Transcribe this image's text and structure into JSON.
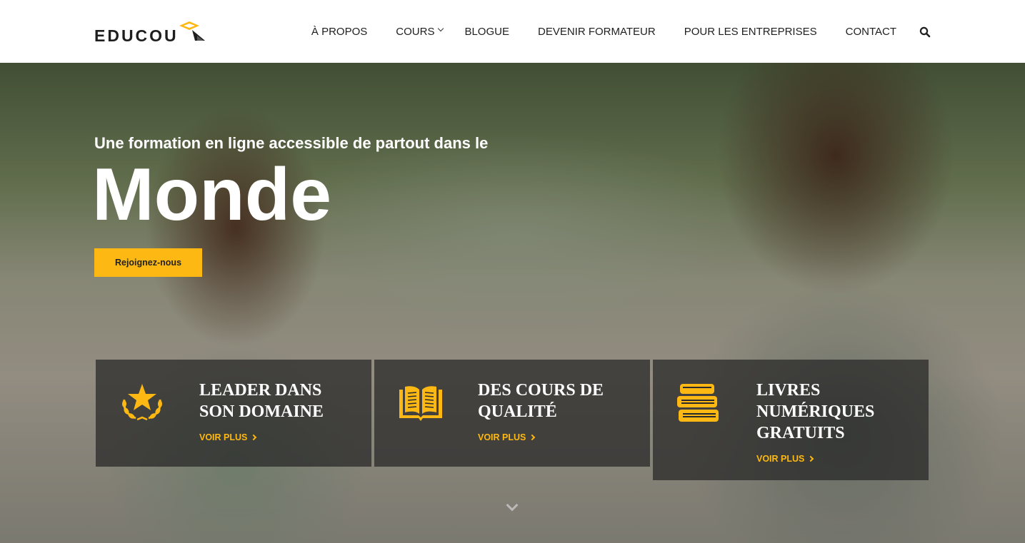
{
  "brand": {
    "logo_text": "EDUCOU",
    "accent_color": "#fdb813"
  },
  "nav": {
    "items": [
      {
        "label": "À PROPOS",
        "has_dropdown": false
      },
      {
        "label": "COURS",
        "has_dropdown": true
      },
      {
        "label": "BLOGUE",
        "has_dropdown": false
      },
      {
        "label": "DEVENIR FORMATEUR",
        "has_dropdown": false
      },
      {
        "label": "POUR LES ENTREPRISES",
        "has_dropdown": false
      },
      {
        "label": "CONTACT",
        "has_dropdown": false
      }
    ],
    "search_icon": "search-icon"
  },
  "hero": {
    "subtitle": "Une formation en ligne accessible de partout dans le",
    "title": "Monde",
    "cta_label": "Rejoignez-nous"
  },
  "features": [
    {
      "title": "LEADER DANS SON DOMAINE",
      "link": "VOIR PLUS",
      "icon": "star-laurel-icon"
    },
    {
      "title": "DES COURS DE QUALITÉ",
      "link": "VOIR PLUS",
      "icon": "open-book-icon"
    },
    {
      "title": "LIVRES NUMÉRIQUES GRATUITS",
      "link": "VOIR PLUS",
      "icon": "book-stack-icon"
    }
  ],
  "scroll_icon": "chevron-down-icon"
}
